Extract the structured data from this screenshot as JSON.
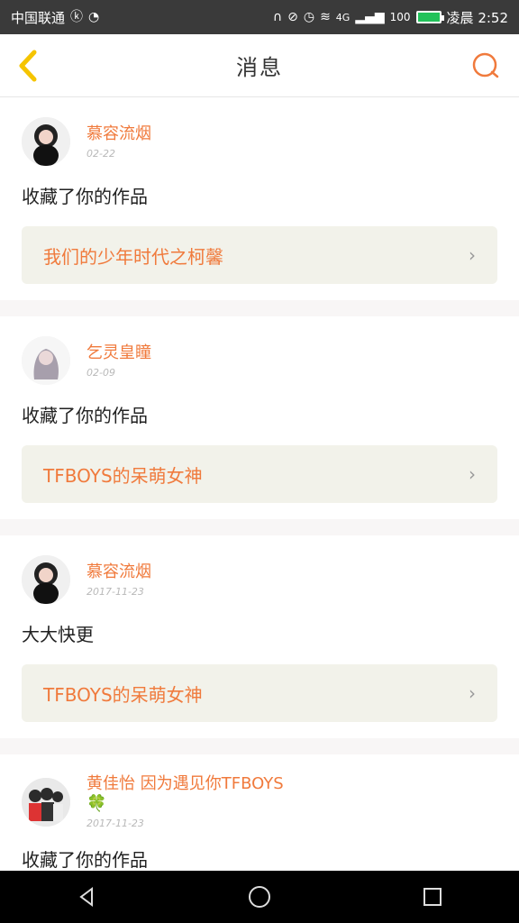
{
  "status": {
    "carrier": "中国联通",
    "signal": "4G",
    "battery": "100",
    "time": "凌晨 2:52"
  },
  "header": {
    "title": "消息"
  },
  "messages": [
    {
      "name": "慕容流烟",
      "date": "02-22",
      "action": "收藏了你的作品",
      "work": "我们的少年时代之柯馨"
    },
    {
      "name": "乞灵皇瞳",
      "date": "02-09",
      "action": "收藏了你的作品",
      "work": "TFBOYS的呆萌女神"
    },
    {
      "name": "慕容流烟",
      "date": "2017-11-23",
      "action": "大大快更",
      "work": "TFBOYS的呆萌女神"
    },
    {
      "name": "黄佳怡 因为遇见你TFBOYS",
      "date": "2017-11-23",
      "action": "收藏了你的作品",
      "extra": "🍀"
    }
  ],
  "colors": {
    "accent": "#f07a3c",
    "back": "#f5c400"
  }
}
